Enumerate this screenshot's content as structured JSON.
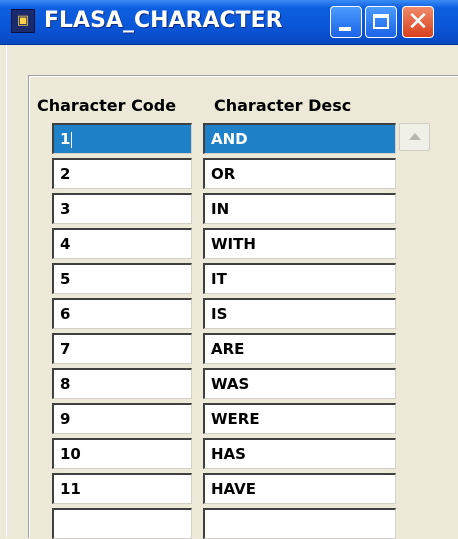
{
  "window": {
    "title": "FLASA_CHARACTER",
    "icon": "forms-app-icon",
    "icon_glyph": "▣"
  },
  "table": {
    "columns": [
      "Character Code",
      "Character Desc"
    ],
    "selected_row": 0,
    "rows": [
      {
        "code": "1",
        "desc": "AND"
      },
      {
        "code": "2",
        "desc": "OR"
      },
      {
        "code": "3",
        "desc": "IN"
      },
      {
        "code": "4",
        "desc": "WITH"
      },
      {
        "code": "5",
        "desc": "IT"
      },
      {
        "code": "6",
        "desc": "IS"
      },
      {
        "code": "7",
        "desc": "ARE"
      },
      {
        "code": "8",
        "desc": "WAS"
      },
      {
        "code": "9",
        "desc": "WERE"
      },
      {
        "code": "10",
        "desc": "HAS"
      },
      {
        "code": "11",
        "desc": "HAVE"
      },
      {
        "code": "",
        "desc": ""
      }
    ]
  },
  "colors": {
    "titlebar": "#0a56d8",
    "selection": "#1f82c8",
    "close_button": "#d8401c",
    "dialog_bg": "#ece9d8"
  }
}
